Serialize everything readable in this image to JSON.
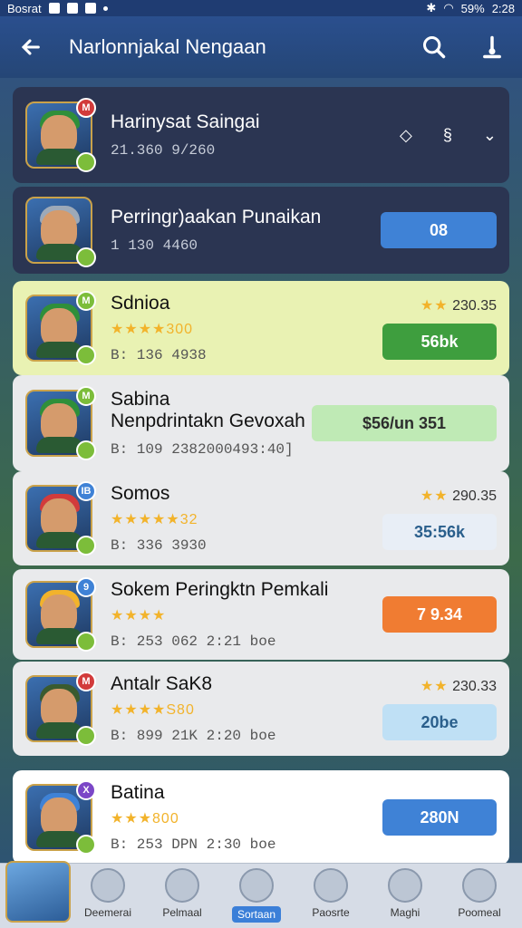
{
  "status": {
    "carrier": "Bosrat",
    "battery": "59%",
    "time": "2:28"
  },
  "header": {
    "title": "Narlonnjakal Nengaan",
    "icons": [
      "back-arrow-icon",
      "search-icon",
      "profile-icon"
    ]
  },
  "list": [
    {
      "name": "Harinysat Saingai",
      "sub": "21.360  9/260",
      "hat": "#2f8f3a",
      "badge_top": "M",
      "badge_top_color": "#d23b3b",
      "bg": "dark",
      "right_icons": [
        "diamond-icon",
        "s-icon",
        "chevron-icon"
      ]
    },
    {
      "name": "Perringr)aakan Punaikan",
      "sub": "1 130  4460",
      "hat": "#9da9b8",
      "badge_top": "",
      "bg": "dark",
      "button_label": "08",
      "button_color": "#3f82d6"
    },
    {
      "name": "Sdnioa",
      "stars": "★★★★300",
      "sub": "B: 136   4938",
      "rating": "230.35",
      "hat": "#2f8f3a",
      "badge_top": "M",
      "badge_top_color": "#7cbd3a",
      "bg": "#e9f2b3",
      "button_label": "56bk",
      "button_color": "#3e9e3e"
    },
    {
      "name": "Sabina",
      "name2": "Nenpdrintakn Gevoxah",
      "sub": "B: 109   2382000493:40]",
      "hat": "#2f8f3a",
      "badge_top": "M",
      "badge_top_color": "#7cbd3a",
      "bg": "#e9eaec",
      "button_label": "$56/un   351",
      "button_color": "#bfeab5"
    },
    {
      "name": "Somos",
      "stars": "★★★★★32",
      "sub": "B: 336   3930",
      "rating": "290.35",
      "hat": "#d23b3b",
      "badge_top": "IB",
      "badge_top_color": "#3f82d6",
      "bg": "#e9eaec",
      "button_label": "35:56k",
      "button_color": "#e8eef6"
    },
    {
      "name": "Sokem Peringktn Pemkali",
      "stars": "★★★★",
      "sub": "B: 253   062 2:21 boe",
      "hat": "#f2b32b",
      "badge_top": "9",
      "badge_top_color": "#3f82d6",
      "bg": "#e9eaec",
      "button_label": "7 9.34",
      "button_color": "#f07c32"
    },
    {
      "name": "Antalr SaK8",
      "stars": "★★★★S80",
      "sub": "B: 899   21K 2:20 boe",
      "rating": "230.33",
      "hat": "#3a5b2f",
      "badge_top": "M",
      "badge_top_color": "#d23b3b",
      "bg": "#e9eaec",
      "button_label": "20be",
      "button_color": "#bfe0f5"
    },
    {
      "name": "Batina",
      "stars": "★★★800",
      "sub": "B: 253   DPN 2:30 boe",
      "hat": "#3f82d6",
      "badge_top": "X",
      "badge_top_color": "#7b47c7",
      "bg": "#ffffff",
      "button_label": "280N",
      "button_color": "#3f82d6"
    }
  ],
  "bottom_nav": [
    {
      "label": "Deemerai"
    },
    {
      "label": "Pelmaal"
    },
    {
      "label": "Sortaan",
      "active": true
    },
    {
      "label": "Paosrte"
    },
    {
      "label": "Maghi"
    },
    {
      "label": "Poomeal"
    }
  ]
}
